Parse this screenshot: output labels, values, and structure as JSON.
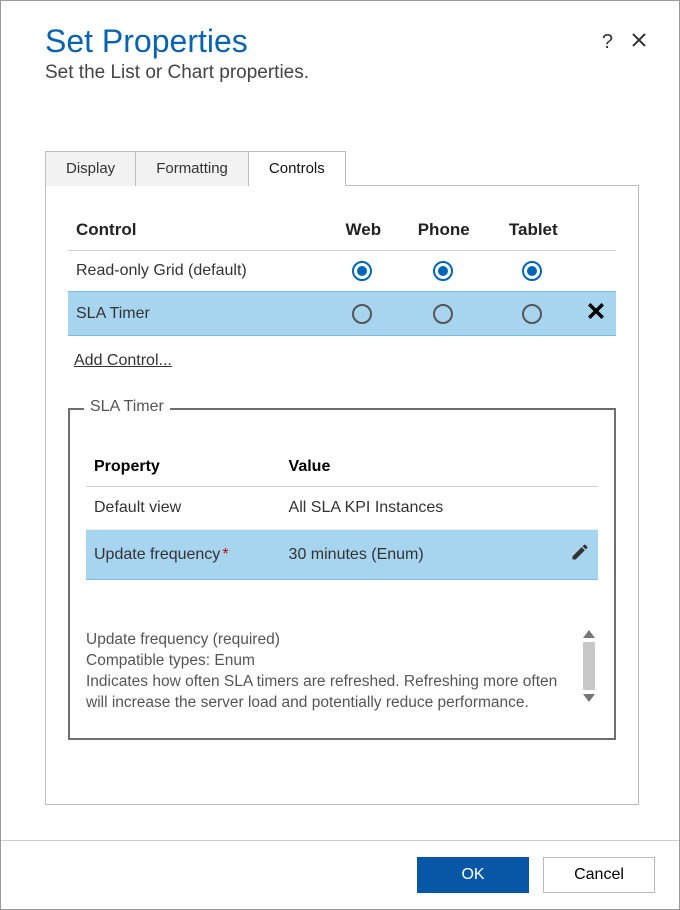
{
  "header": {
    "title": "Set Properties",
    "subtitle": "Set the List or Chart properties."
  },
  "tabs": {
    "display": "Display",
    "formatting": "Formatting",
    "controls": "Controls"
  },
  "controls_table": {
    "columns": {
      "control": "Control",
      "web": "Web",
      "phone": "Phone",
      "tablet": "Tablet"
    },
    "rows": [
      {
        "name": "Read-only Grid (default)",
        "web": true,
        "phone": true,
        "tablet": true,
        "removable": false
      },
      {
        "name": "SLA Timer",
        "web": false,
        "phone": false,
        "tablet": false,
        "removable": true
      }
    ],
    "add_link": "Add Control..."
  },
  "fieldset": {
    "legend": "SLA Timer",
    "columns": {
      "property": "Property",
      "value": "Value"
    },
    "rows": [
      {
        "property": "Default view",
        "value": "All SLA KPI Instances",
        "required": false,
        "selected": false,
        "editable": false
      },
      {
        "property": "Update frequency",
        "value": "30 minutes (Enum)",
        "required": true,
        "selected": true,
        "editable": true
      }
    ],
    "description": {
      "line1": "Update frequency (required)",
      "line2": "Compatible types: Enum",
      "body": "Indicates how often SLA timers are refreshed. Refreshing more often will increase the server load and potentially reduce performance."
    }
  },
  "footer": {
    "ok": "OK",
    "cancel": "Cancel"
  }
}
